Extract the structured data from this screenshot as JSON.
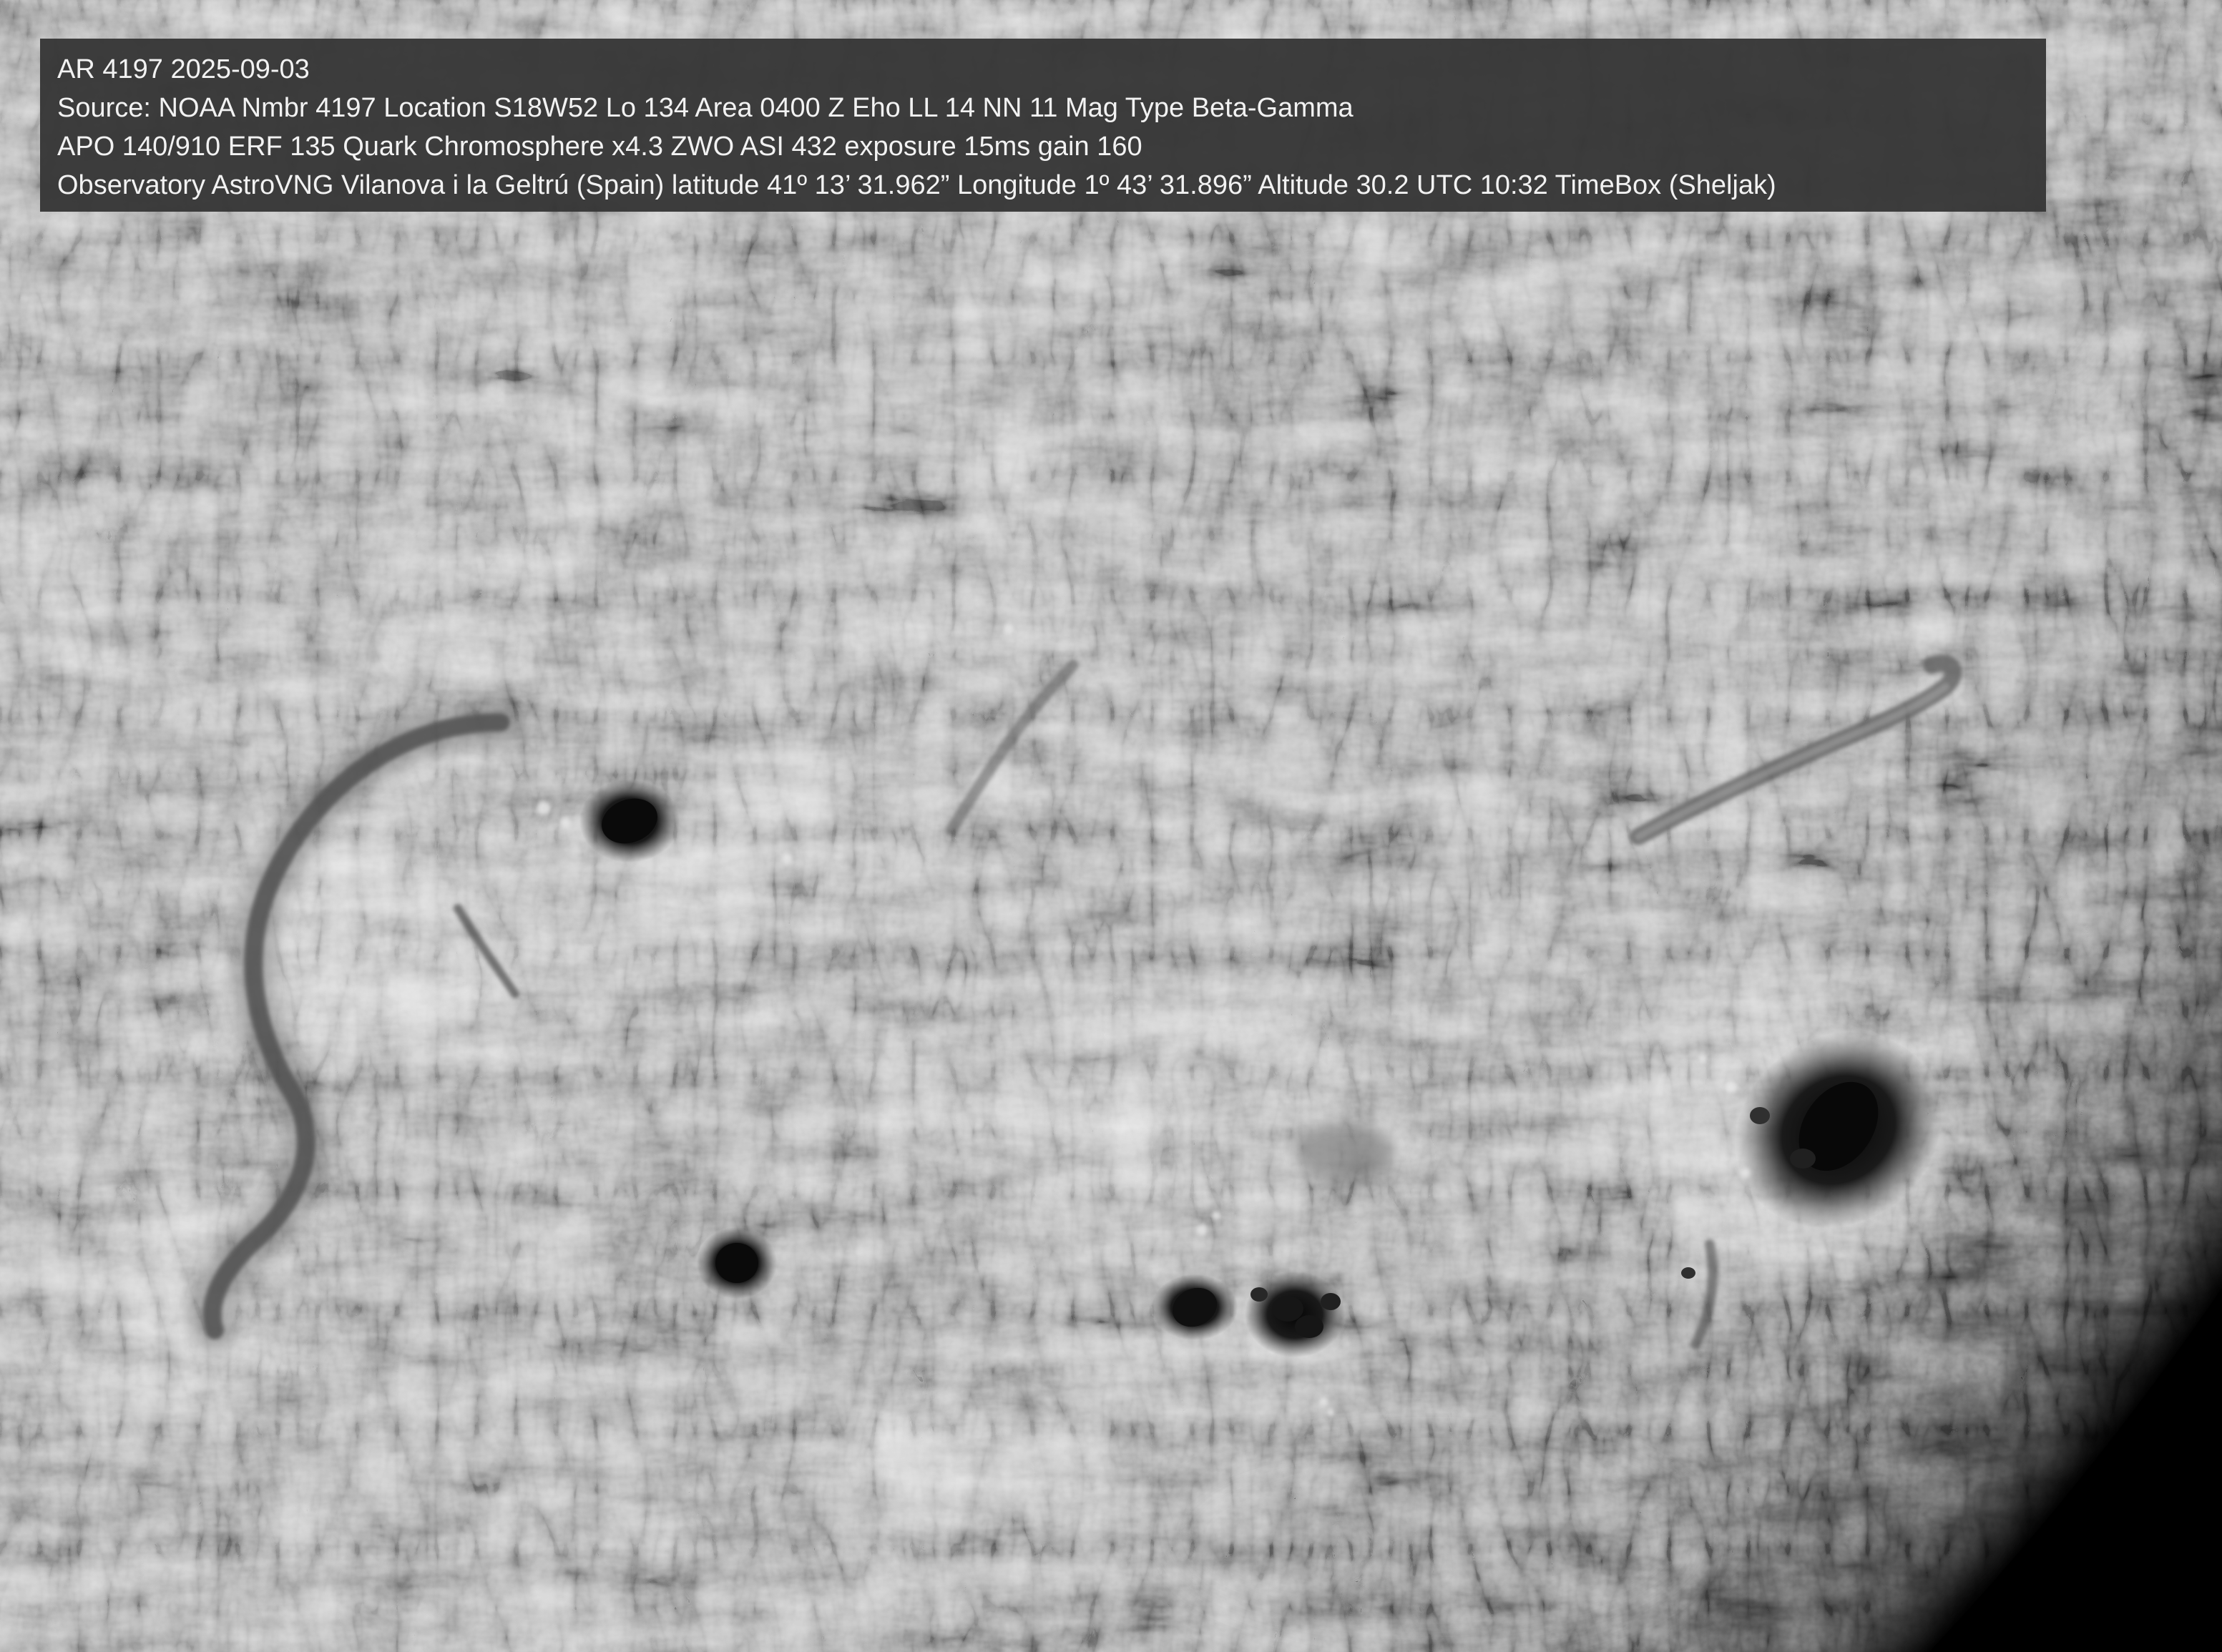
{
  "caption": {
    "lines": [
      "AR 4197 2025-09-03",
      "Source: NOAA Nmbr 4197 Location S18W52 Lo 134 Area 0400 Z Eho LL  14 NN 11 Mag Type Beta-Gamma",
      "APO 140/910 ERF 135 Quark Chromosphere x4.3 ZWO ASI 432 exposure 15ms gain 160",
      "Observatory AstroVNG Vilanova i la Geltrú (Spain) latitude 41º 13’ 31.962” Longitude 1º 43’ 31.896” Altitude 30.2  UTC 10:32 TimeBox (Sheljak)"
    ]
  },
  "colors": {
    "chromosphere_base": "#8e8e8e",
    "plage": "#c8c8c8",
    "filament": "#4a4a4a",
    "sunspot_umbra": "#0d0d0d",
    "sky": "#000000",
    "caption_background": "#363636",
    "caption_text": "#f2f2f2"
  }
}
